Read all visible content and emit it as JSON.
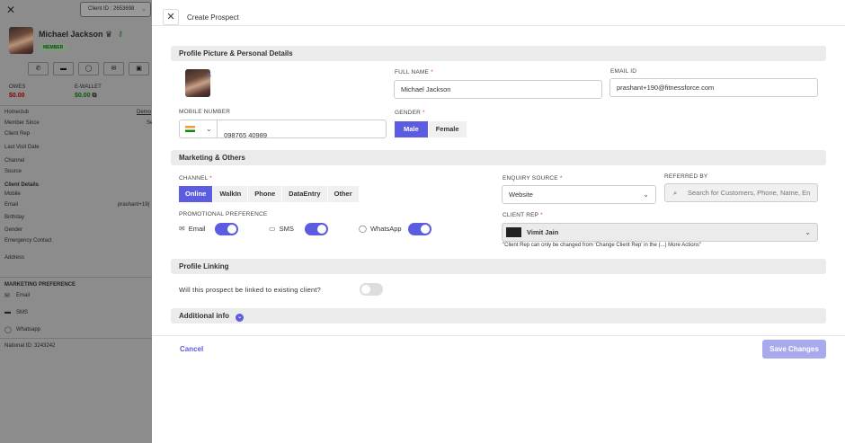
{
  "left": {
    "client_id": "Client ID : 2653698",
    "name": "Michael Jackson",
    "badge": "MEMBER",
    "owes_label": "OWES",
    "owes_value": "$0.00",
    "ewallet_label": "E-WALLET",
    "ewallet_value": "$0.00",
    "info": [
      {
        "label": "Homeclub",
        "value": "Demo"
      },
      {
        "label": "Member Since",
        "value": "Se"
      },
      {
        "label": "Client Rep",
        "value": ""
      },
      {
        "label": "Last Visit Date",
        "value": ""
      },
      {
        "label": "Channel",
        "value": ""
      },
      {
        "label": "Source",
        "value": ""
      }
    ],
    "client_details_title": "Client Details",
    "details": [
      {
        "label": "Mobile",
        "value": ""
      },
      {
        "label": "Email",
        "value": "prashant+19("
      },
      {
        "label": "Birthday",
        "value": ""
      },
      {
        "label": "Gender",
        "value": ""
      },
      {
        "label": "Emergency Contact",
        "value": ""
      },
      {
        "label": "Address",
        "value": ""
      }
    ],
    "marketing_title": "MARKETING PREFERENCE",
    "prefs": [
      "Email",
      "SMS",
      "Whatsapp"
    ],
    "national_id": "National ID: 3243242"
  },
  "modal": {
    "title": "Create Prospect",
    "sections": {
      "profile": "Profile Picture & Personal Details",
      "marketing": "Marketing & Others",
      "linking": "Profile Linking",
      "additional": "Additional info"
    },
    "full_name_label": "FULL NAME",
    "full_name_value": "Michael Jackson",
    "email_label": "EMAIL ID",
    "email_value": "prashant+190@fitnessforce.com",
    "mobile_label": "MOBILE NUMBER",
    "mobile_value": "098765 40989",
    "gender_label": "GENDER",
    "gender_options": [
      "Male",
      "Female"
    ],
    "gender_selected": "Male",
    "channel_label": "CHANNEL",
    "channel_options": [
      "Online",
      "WalkIn",
      "Phone",
      "DataEntry",
      "Other"
    ],
    "channel_selected": "Online",
    "enquiry_label": "ENQUIRY SOURCE",
    "enquiry_value": "Website",
    "referred_label": "REFERRED BY",
    "referred_placeholder": "Search for Customers, Phone, Name, En",
    "promo_label": "PROMOTIONAL PREFERENCE",
    "promo": [
      {
        "label": "Email",
        "on": true
      },
      {
        "label": "SMS",
        "on": true
      },
      {
        "label": "WhatsApp",
        "on": true
      }
    ],
    "client_rep_label": "CLIENT REP",
    "client_rep_value": "Vimit Jain",
    "client_rep_note": "\"Client Rep can only be changed from 'Change Client Rep' in the (...) More Actions\"",
    "link_question": "Will this prospect be linked to existing client?",
    "link_on": false,
    "cancel": "Cancel",
    "save": "Save Changes"
  },
  "colors": {
    "accent": "#5c5ce0",
    "overlay": "#8c8c8c",
    "save_disabled": "#a9a9ee"
  }
}
